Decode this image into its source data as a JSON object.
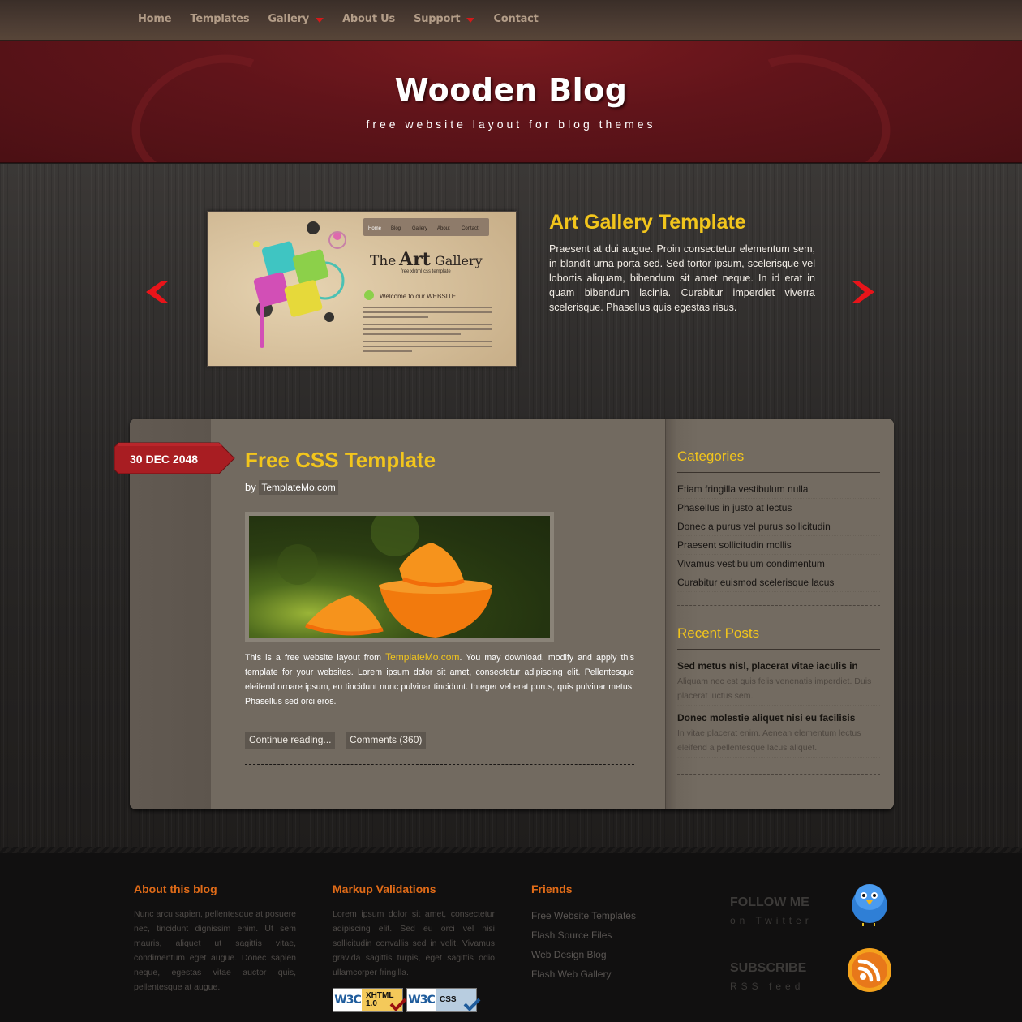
{
  "nav": {
    "items": [
      {
        "label": "Home",
        "has_dropdown": false
      },
      {
        "label": "Templates",
        "has_dropdown": false
      },
      {
        "label": "Gallery",
        "has_dropdown": true
      },
      {
        "label": "About Us",
        "has_dropdown": false
      },
      {
        "label": "Support",
        "has_dropdown": true
      },
      {
        "label": "Contact",
        "has_dropdown": false
      }
    ]
  },
  "header": {
    "title": "Wooden Blog",
    "tagline": "free website layout for blog themes"
  },
  "slider": {
    "prev_icon": "chevron-left-icon",
    "next_icon": "chevron-right-icon",
    "slide": {
      "title": "Art Gallery Template",
      "text": "Praesent at dui augue. Proin consectetur elementum sem, in blandit urna porta sed. Sed tortor ipsum, scelerisque vel lobortis aliquam, bibendum sit amet neque. In id erat in quam bibendum lacinia. Curabitur imperdiet viverra scelerisque. Phasellus quis egestas risus.",
      "image": {
        "nav": [
          "Home",
          "Blog",
          "Gallery",
          "About",
          "Contact"
        ],
        "title_the": "The",
        "title_art": "Art",
        "title_gallery": "Gallery",
        "subtitle": "free xhtml css template",
        "welcome": "Welcome to our WEBSITE"
      }
    }
  },
  "post": {
    "date": "30 DEC 2048",
    "title": "Free CSS Template",
    "by_label": "by",
    "author": "TemplateMo.com",
    "image_alt": "orange slices",
    "body_prefix": "This is a free website layout from ",
    "body_link": "TemplateMo.com",
    "body_suffix": ". You may download, modify and apply this template for your websites. Lorem ipsum dolor sit amet, consectetur adipiscing elit. Pellentesque eleifend ornare ipsum, eu tincidunt nunc pulvinar tincidunt. Integer vel erat purus, quis pulvinar metus. Phasellus sed orci eros.",
    "continue_label": "Continue reading...",
    "comments_label": "Comments (360)"
  },
  "sidebar": {
    "categories_heading": "Categories",
    "categories": [
      "Etiam fringilla vestibulum nulla",
      "Phasellus in justo at lectus",
      "Donec a purus vel purus sollicitudin",
      "Praesent sollicitudin mollis",
      "Vivamus vestibulum condimentum",
      "Curabitur euismod scelerisque lacus"
    ],
    "recent_heading": "Recent Posts",
    "recent_posts": [
      {
        "title": "Sed metus nisl, placerat vitae iaculis in",
        "excerpt": "Aliquam nec est quis felis venenatis imperdiet. Duis placerat luctus sem."
      },
      {
        "title": "Donec molestie aliquet nisi eu facilisis",
        "excerpt": "In vitae placerat enim. Aenean elementum lectus eleifend a pellentesque lacus aliquet."
      }
    ]
  },
  "footer": {
    "about": {
      "heading": "About this blog",
      "text": "Nunc arcu sapien, pellentesque at posuere nec, tincidunt dignissim enim. Ut sem mauris, aliquet ut sagittis vitae, condimentum eget augue. Donec sapien neque, egestas vitae auctor quis, pellentesque at augue."
    },
    "validations": {
      "heading": "Markup Validations",
      "text": "Lorem ipsum dolor sit amet, consectetur adipiscing elit. Sed eu orci vel nisi sollicitudin convallis sed in velit. Vivamus gravida sagittis turpis, eget sagittis odio ullamcorper fringilla.",
      "badges": [
        {
          "w3c": "W3C",
          "label_line1": "XHTML",
          "label_line2": "1.0",
          "color": "#f4c95a"
        },
        {
          "w3c": "W3C",
          "label_line1": "CSS",
          "label_line2": "",
          "color": "#b8cde0"
        }
      ]
    },
    "friends": {
      "heading": "Friends",
      "links": [
        "Free Website Templates",
        "Flash Source Files",
        "Web Design Blog",
        "Flash Web Gallery"
      ]
    },
    "social": [
      {
        "title": "FOLLOW ME",
        "subtitle": "on Twitter",
        "icon": "twitter-bird-icon"
      },
      {
        "title": "SUBSCRIBE",
        "subtitle": "RSS feed",
        "icon": "rss-icon"
      }
    ]
  },
  "colors": {
    "accent_yellow": "#f2c51c",
    "footer_heading_orange": "#e06b18",
    "header_red": "#6a161c",
    "ribbon_red": "#a81d22",
    "arrow_red": "#e8141a",
    "panel_bg": "#726a60"
  }
}
